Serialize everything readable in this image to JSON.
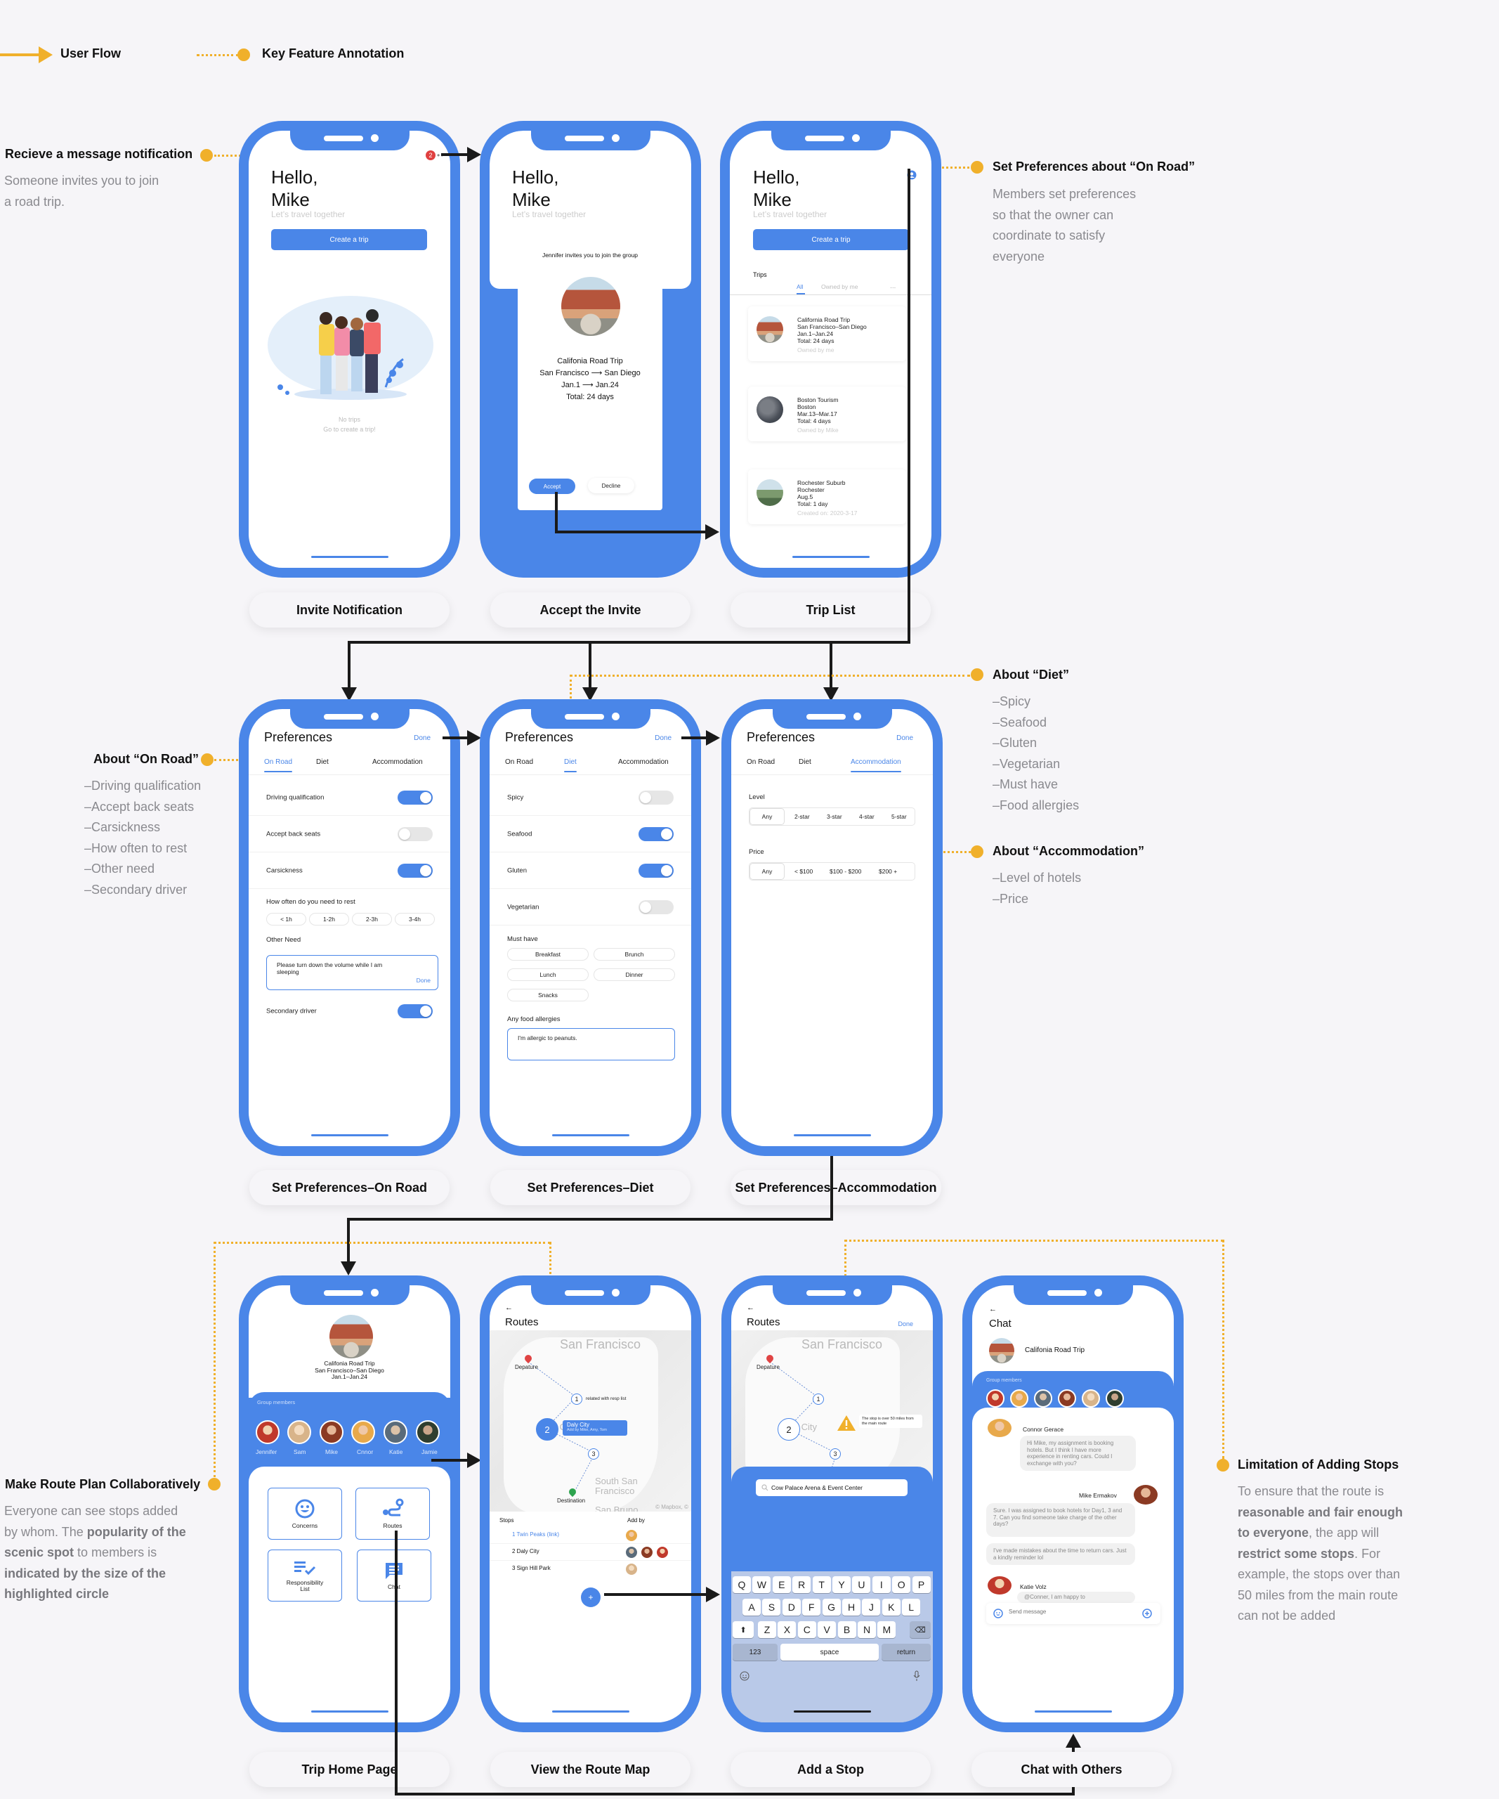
{
  "legend": {
    "user_flow": "User Flow",
    "key_feature": "Key Feature Annotation",
    "colors": {
      "flow": "#1a1a1a",
      "annotation": "#f0b02b",
      "phone_frame": "#4a86e8",
      "background": "#f6f5f8"
    }
  },
  "annotations": {
    "notification": {
      "title": "Recieve a message notification",
      "body": [
        "Someone invites you to join",
        "a road trip."
      ]
    },
    "on_road_prefs": {
      "title": "Set Preferences about “On Road”",
      "body": [
        "Members set preferences",
        "so that the owner can",
        "coordinate to satisfy",
        "everyone"
      ]
    },
    "about_on_road": {
      "title": "About “On Road”",
      "items": [
        "–Driving qualification",
        "–Accept back seats",
        "–Carsickness",
        "–How often to rest",
        "–Other need",
        "–Secondary driver"
      ]
    },
    "about_diet": {
      "title": "About “Diet”",
      "items": [
        "–Spicy",
        "–Seafood",
        "–Gluten",
        "–Vegetarian",
        "–Must have",
        "–Food allergies"
      ]
    },
    "about_accommodation": {
      "title": "About “Accommodation”",
      "items": [
        "–Level of hotels",
        "–Price"
      ]
    },
    "route_collab": {
      "title": "Make Route Plan Collaboratively",
      "parts": [
        "Everyone can see stops added by whom. The ",
        "popularity of the scenic spot",
        " to members is ",
        "indicated by the size of the highlighted circle"
      ]
    },
    "limitation": {
      "title": "Limitation of Adding Stops",
      "parts": [
        "To ensure that the route is ",
        "reasonable and fair enough to everyone",
        ", the app will ",
        "restrict some stops",
        ". For example, the stops over than 50 miles from the main route can not be added"
      ]
    }
  },
  "screens": {
    "invite_notification": {
      "caption": "Invite Notification",
      "greeting": "Hello,\nMike",
      "greeting_1": "Hello,",
      "greeting_2": "Mike",
      "tagline": "Let’s travel together",
      "create_button": "Create a trip",
      "badge_count": "2",
      "more": "••",
      "empty_title": "No trips",
      "empty_sub": "Go to create a trip!"
    },
    "accept_invite": {
      "caption": "Accept the Invite",
      "greeting_1": "Hello,",
      "greeting_2": "Mike",
      "tagline": "Let’s travel together",
      "invite_text": "Jennifer invites you to join the group",
      "trip_name": "Califonia Road Trip",
      "route": "San Francisco ⟶ San Diego",
      "dates": "Jan.1 ⟶ Jan.24",
      "total": "Total: 24 days",
      "accept": "Accept",
      "decline": "Decline"
    },
    "trip_list": {
      "caption": "Trip List",
      "greeting_1": "Hello,",
      "greeting_2": "Mike",
      "tagline": "Let’s travel together",
      "create_button": "Create a trip",
      "section": "Trips",
      "tabs": [
        "All",
        "Owned by me",
        "…"
      ],
      "trips": [
        {
          "name": "California Road Trip",
          "place": "San Francisco–San Diego",
          "dates": "Jan.1–Jan.24",
          "total": "Total: 24 days",
          "meta": "Owned by me"
        },
        {
          "name": "Boston Tourism",
          "place": "Boston",
          "dates": "Mar.13–Mar.17",
          "total": "Total: 4 days",
          "meta": "Owned by Mike"
        },
        {
          "name": "Rochester Suburb",
          "place": "Rochester",
          "dates": "Aug.5",
          "total": "Total: 1 day",
          "meta": "Created on: 2020-3-17"
        }
      ]
    },
    "pref_on_road": {
      "caption": "Set Preferences–On Road",
      "title": "Preferences",
      "done": "Done",
      "tabs": [
        "On Road",
        "Diet",
        "Accommodation"
      ],
      "toggles": [
        {
          "label": "Driving qualification",
          "on": true
        },
        {
          "label": "Accept back seats",
          "on": false
        },
        {
          "label": "Carsickness",
          "on": true
        }
      ],
      "rest_label": "How often do you need to rest",
      "rest_options": [
        "< 1h",
        "1-2h",
        "2-3h",
        "3-4h"
      ],
      "other_label": "Other Need",
      "other_value": "Please turn down the volume while I am sleeping",
      "other_done": "Done",
      "secondary": {
        "label": "Secondary driver",
        "on": true
      }
    },
    "pref_diet": {
      "caption": "Set Preferences–Diet",
      "title": "Preferences",
      "done": "Done",
      "tabs": [
        "On Road",
        "Diet",
        "Accommodation"
      ],
      "toggles": [
        {
          "label": "Spicy",
          "on": false
        },
        {
          "label": "Seafood",
          "on": true
        },
        {
          "label": "Gluten",
          "on": true
        },
        {
          "label": "Vegetarian",
          "on": false
        }
      ],
      "must_have_label": "Must have",
      "must_have": [
        "Breakfast",
        "Brunch",
        "Lunch",
        "Dinner",
        "Snacks"
      ],
      "allergy_label": "Any food allergies",
      "allergy_value": "I'm allergic to peanuts."
    },
    "pref_accommodation": {
      "caption": "Set Preferences–Accommodation",
      "title": "Preferences",
      "done": "Done",
      "tabs": [
        "On Road",
        "Diet",
        "Accommodation"
      ],
      "level_label": "Level",
      "levels": [
        "Any",
        "2-star",
        "3-star",
        "4-star",
        "5-star"
      ],
      "price_label": "Price",
      "prices": [
        "Any",
        "< $100",
        "$100 - $200",
        "$200 +"
      ]
    },
    "trip_home": {
      "caption": "Trip Home Page",
      "trip_name": "Califonia Road Trip",
      "route": "San Francisco–San Diego",
      "dates": "Jan.1–Jan.24",
      "members_label": "Group members",
      "members": [
        "Jennifer",
        "Sam",
        "Mike",
        "Cnnor",
        "Katie",
        "Jamie"
      ],
      "tiles": [
        "Concerns",
        "Routes",
        "Responsibility List",
        "Chat"
      ]
    },
    "route_map": {
      "caption": "View the Route Map",
      "back": "←",
      "title": "Routes",
      "map_cities": [
        "San Francisco",
        "Daly City",
        "South San Francisco",
        "San Bruno"
      ],
      "departure": "Depature",
      "destination": "Destination",
      "stop1_note": "related with resp list",
      "popup_title": "Daly City",
      "popup_sub": "Add by Mike, Amy, Tom",
      "attribution": "© Mapbox, ©",
      "stops_header": "Stops",
      "addby_header": "Add by",
      "stops": [
        {
          "label": "1 Twin Peaks (link)",
          "link": true
        },
        {
          "label": "2 Daly City",
          "link": false
        },
        {
          "label": "3 Sign Hill Park",
          "link": false
        }
      ],
      "add_button": "+"
    },
    "add_stop": {
      "caption": "Add a Stop",
      "back": "←",
      "title": "Routes",
      "done": "Done",
      "map_cities": [
        "San Francisco",
        "Daly City"
      ],
      "departure": "Depature",
      "warning": "The stop  is over 50 miles from the main route",
      "search_value": "Cow Palace Arena & Event Center",
      "keyboard_rows": [
        [
          "Q",
          "W",
          "E",
          "R",
          "T",
          "Y",
          "U",
          "I",
          "O",
          "P"
        ],
        [
          "A",
          "S",
          "D",
          "F",
          "G",
          "H",
          "J",
          "K",
          "L"
        ],
        [
          "Z",
          "X",
          "C",
          "V",
          "B",
          "N",
          "M"
        ]
      ],
      "key_123": "123",
      "key_space": "space",
      "key_return": "return"
    },
    "chat": {
      "caption": "Chat with Others",
      "back": "←",
      "title": "Chat",
      "group_name": "Califonia Road Trip",
      "members_label": "Group members",
      "messages": [
        {
          "author": "Connor Gerace",
          "text": "Hi Mike, my assignment is booking hotels. But I think I have more experience in renting cars. Could I exchange with you?"
        },
        {
          "author": "Mike Ermakov",
          "text": "Sure. I was assigned to book hotels for Day1, 3 and 7. Can you find someone take charge of the other days?"
        },
        {
          "author": "",
          "text": "I've made mistakes about the time to return cars. Just a kindly reminder lol"
        },
        {
          "author": "Katie Volz",
          "text": "@Conner, I am happy to"
        }
      ],
      "input_placeholder": "Send message"
    }
  }
}
